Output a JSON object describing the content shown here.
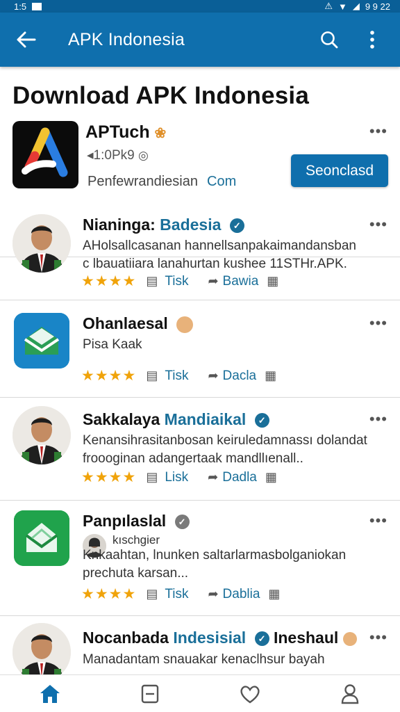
{
  "status_bar": {
    "time": "1:5",
    "right_text": "9 9 22"
  },
  "app_bar": {
    "title": "APK Indonesia"
  },
  "page": {
    "title": "Download APK Indonesia"
  },
  "featured": {
    "name": "APTuch",
    "meta": "◂1:0Pk9",
    "developer": "Penfewrandiesian",
    "developer_link": "Com",
    "button": "Seonclasd"
  },
  "items": [
    {
      "name": "Nianinga:",
      "name_accent": "Badesia",
      "desc_1": "AHolsallcasanan hannellsanpakaimandansban",
      "desc_2": "c lbauatiiara lanahurtan kushee 11STHr.APK.",
      "action_1": "Tisk",
      "action_2": "Bawia"
    },
    {
      "name": "Ohanlaesal",
      "desc_1": "Pisa Kaak",
      "action_1": "Tisk",
      "action_2": "Dacla"
    },
    {
      "name": "Sakkalaya",
      "name_accent": "Mandiaikal",
      "desc_1": "Kenansihrasitanbosan keiruledamnassı dolandat",
      "desc_2": "froooginan adangertaak mandllıenall..",
      "action_1": "Lisk",
      "action_2": "Dadla"
    },
    {
      "name": "Panpılaslal",
      "sub": "kıschgier",
      "desc_1": "Knkaahtan, lnunken saltarlarmasbolganiokan",
      "desc_2": "prechuta karsan...",
      "action_1": "Tisk",
      "action_2": "Dablia"
    },
    {
      "name": "Nocanbada",
      "name_accent": "Indesisial",
      "name_suffix": "Ineshaul",
      "desc_1": "Manadantam snauakar kenaclhsur bayah"
    }
  ],
  "stars": "★★★★",
  "colors": {
    "primary": "#0f6fad",
    "accent": "#1a6f99",
    "star": "#f0a30a"
  },
  "icons": [
    "back-arrow-icon",
    "search-icon",
    "more-vert-icon",
    "home-icon",
    "document-icon",
    "heart-icon",
    "profile-icon"
  ]
}
